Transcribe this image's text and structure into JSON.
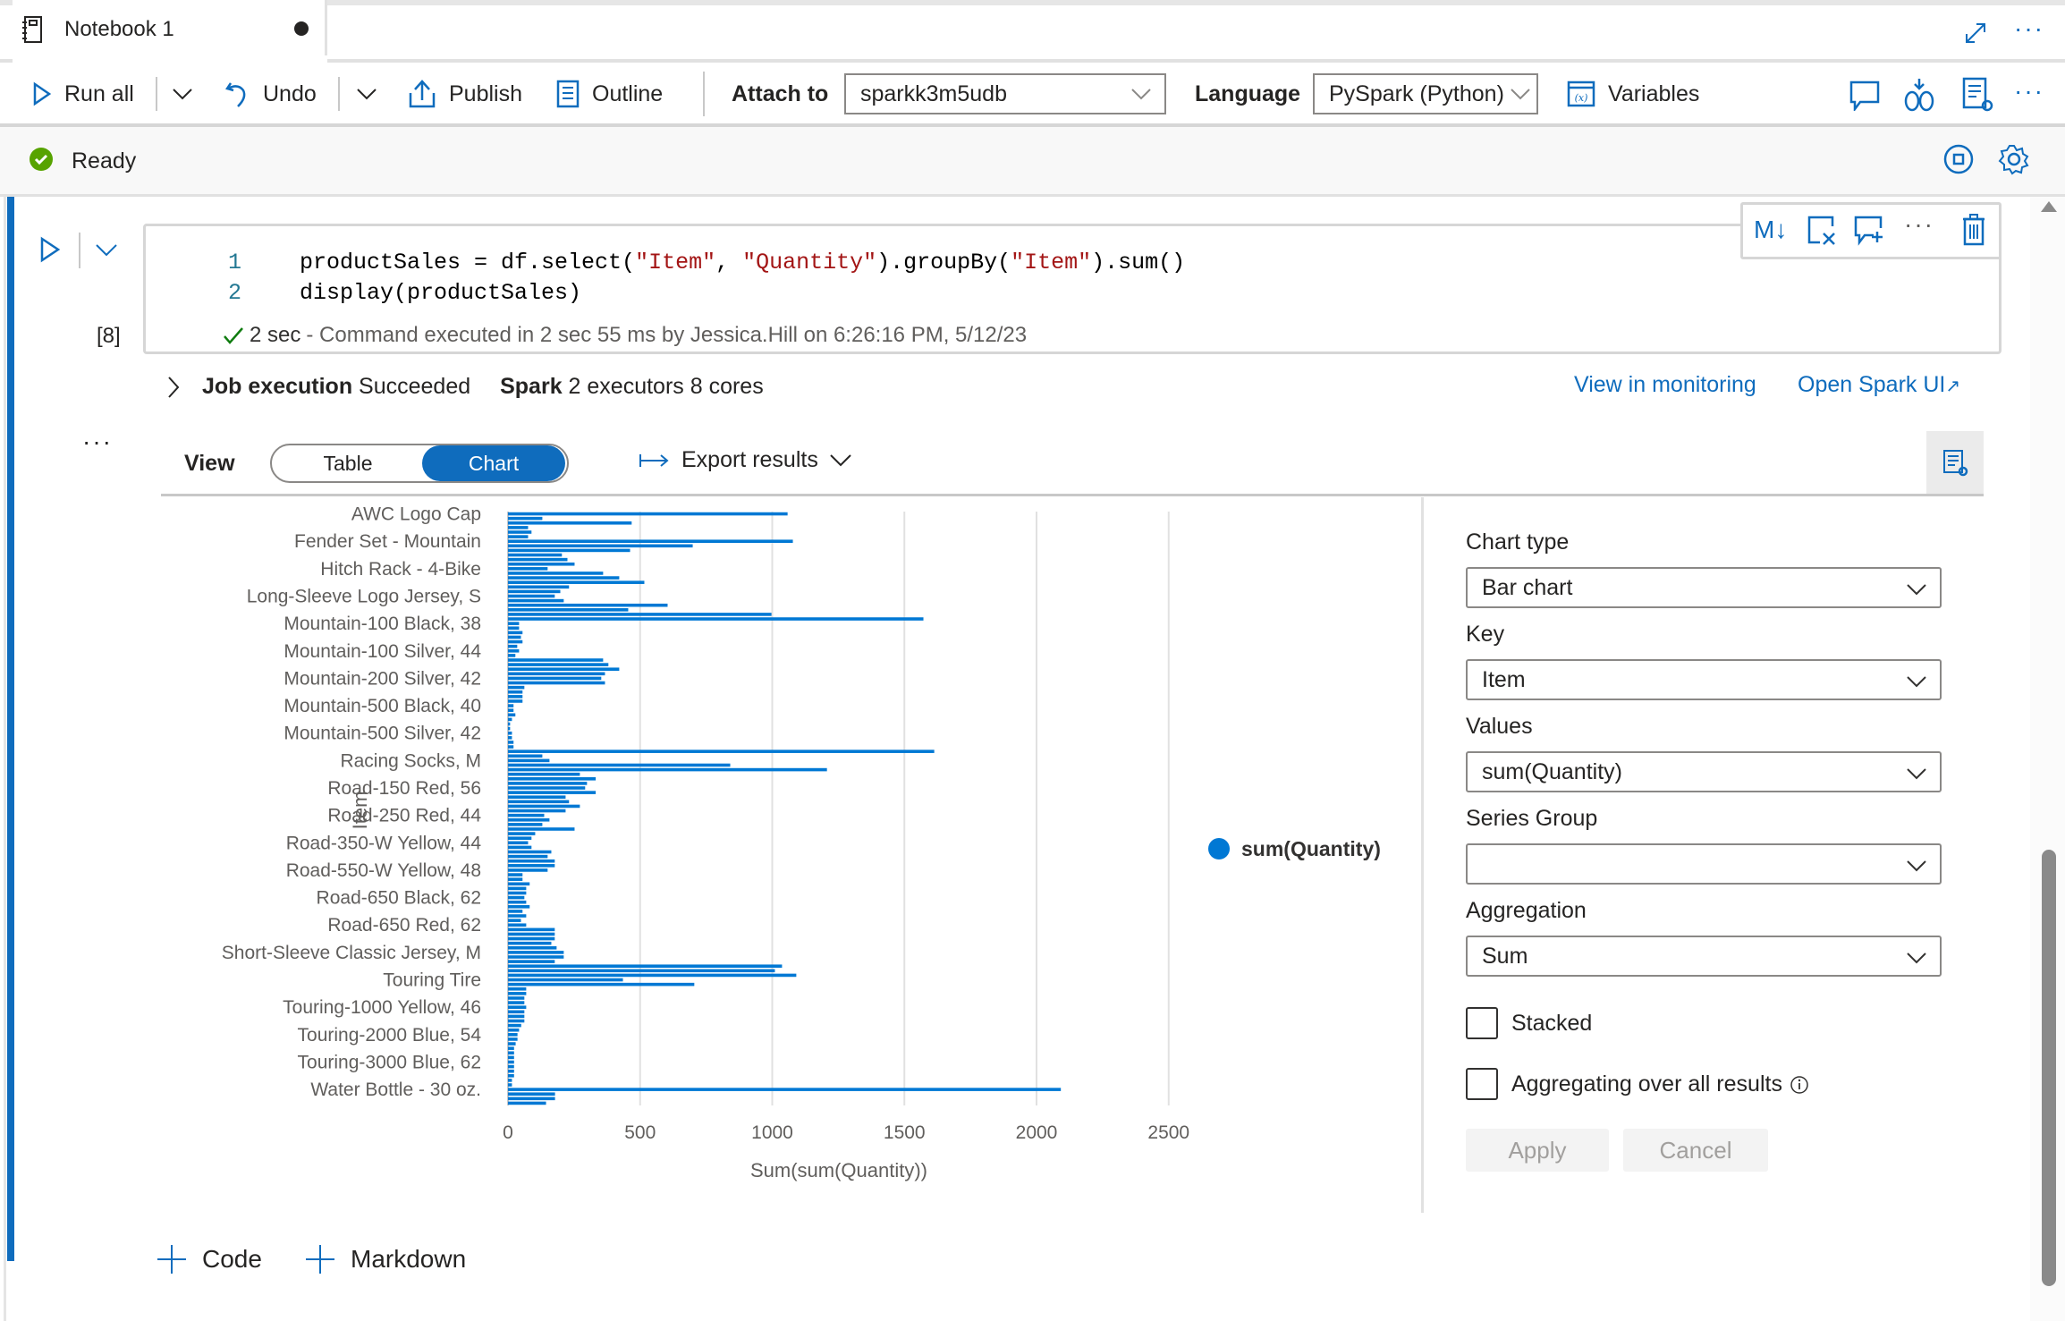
{
  "tab": {
    "title": "Notebook 1",
    "unsaved": true
  },
  "window_actions": {
    "expand_icon": "expand-icon",
    "more_icon": "more-icon"
  },
  "toolbar": {
    "run_all": "Run all",
    "undo": "Undo",
    "publish": "Publish",
    "outline": "Outline",
    "attach_to_label": "Attach to",
    "attach_to_value": "sparkk3m5udb",
    "language_label": "Language",
    "language_value": "PySpark (Python)",
    "variables": "Variables"
  },
  "status": {
    "text": "Ready",
    "color": "#57a300"
  },
  "cell": {
    "exec_count": "[8]",
    "lines": [
      {
        "no": "1",
        "parts": [
          "productSales = df.select(",
          "\"Item\"",
          ", ",
          "\"Quantity\"",
          ").groupBy(",
          "\"Item\"",
          ").sum()"
        ]
      },
      {
        "no": "2",
        "parts": [
          "display(productSales)"
        ]
      }
    ],
    "exec_duration": "2 sec",
    "exec_message": " - Command executed in 2 sec 55 ms by Jessica.Hill on 6:26:16 PM, 5/12/23",
    "toolbar": {
      "markdown_label": "M↓"
    }
  },
  "job": {
    "label": "Job execution",
    "status": "Succeeded",
    "spark_label": "Spark",
    "spark_info": "2 executors 8 cores",
    "view_monitoring": "View in monitoring",
    "open_spark_ui": "Open Spark UI"
  },
  "view": {
    "label": "View",
    "options": [
      "Table",
      "Chart"
    ],
    "selected": "Chart",
    "export": "Export results"
  },
  "settings": {
    "chart_type_label": "Chart type",
    "chart_type": "Bar chart",
    "key_label": "Key",
    "key": "Item",
    "values_label": "Values",
    "values": "sum(Quantity)",
    "series_group_label": "Series Group",
    "series_group": "",
    "aggregation_label": "Aggregation",
    "aggregation": "Sum",
    "stacked_label": "Stacked",
    "stacked": false,
    "aggregating_label": "Aggregating over all results",
    "aggregating": false,
    "apply": "Apply",
    "cancel": "Cancel"
  },
  "add_cell": {
    "code": "Code",
    "markdown": "Markdown"
  },
  "colors": {
    "accent": "#0f6cbd",
    "bar": "#0078d4"
  },
  "chart_data": {
    "type": "bar",
    "orientation": "horizontal",
    "xlabel": "Sum(sum(Quantity))",
    "ylabel": "Item",
    "xlim": [
      0,
      2500
    ],
    "xticks": [
      0,
      500,
      1000,
      1500,
      2000,
      2500
    ],
    "grid": true,
    "legend": {
      "entries": [
        "sum(Quantity)"
      ],
      "position": "right"
    },
    "visible_category_labels": [
      {
        "index": 0,
        "label": "AWC Logo Cap"
      },
      {
        "index": 6,
        "label": "Fender Set - Mountain"
      },
      {
        "index": 12,
        "label": "Hitch Rack - 4-Bike"
      },
      {
        "index": 18,
        "label": "Long-Sleeve Logo Jersey, S"
      },
      {
        "index": 24,
        "label": "Mountain-100 Black, 38"
      },
      {
        "index": 30,
        "label": "Mountain-100 Silver, 44"
      },
      {
        "index": 36,
        "label": "Mountain-200 Silver, 42"
      },
      {
        "index": 42,
        "label": "Mountain-500 Black, 40"
      },
      {
        "index": 48,
        "label": "Mountain-500 Silver, 42"
      },
      {
        "index": 54,
        "label": "Racing Socks, M"
      },
      {
        "index": 60,
        "label": "Road-150 Red, 56"
      },
      {
        "index": 66,
        "label": "Road-250 Red, 44"
      },
      {
        "index": 72,
        "label": "Road-350-W Yellow, 44"
      },
      {
        "index": 78,
        "label": "Road-550-W Yellow, 48"
      },
      {
        "index": 84,
        "label": "Road-650 Black, 62"
      },
      {
        "index": 90,
        "label": "Road-650 Red, 62"
      },
      {
        "index": 96,
        "label": "Short-Sleeve Classic Jersey, M"
      },
      {
        "index": 102,
        "label": "Touring Tire"
      },
      {
        "index": 108,
        "label": "Touring-1000 Yellow, 46"
      },
      {
        "index": 114,
        "label": "Touring-2000 Blue, 54"
      },
      {
        "index": 120,
        "label": "Touring-3000 Blue, 62"
      },
      {
        "index": 126,
        "label": "Water Bottle - 30 oz."
      }
    ],
    "values": [
      1058,
      130,
      468,
      76,
      89,
      76,
      1078,
      699,
      462,
      204,
      225,
      252,
      150,
      360,
      421,
      516,
      231,
      198,
      177,
      211,
      604,
      455,
      997,
      1572,
      42,
      42,
      55,
      49,
      55,
      35,
      42,
      28,
      360,
      380,
      421,
      367,
      353,
      367,
      62,
      55,
      55,
      55,
      21,
      21,
      28,
      15,
      8,
      8,
      15,
      15,
      21,
      21,
      1613,
      130,
      157,
      841,
      1207,
      272,
      332,
      299,
      292,
      332,
      218,
      231,
      272,
      218,
      137,
      157,
      130,
      252,
      103,
      89,
      76,
      89,
      164,
      150,
      177,
      177,
      150,
      55,
      55,
      82,
      69,
      69,
      62,
      69,
      82,
      55,
      69,
      49,
      69,
      177,
      177,
      177,
      164,
      184,
      211,
      211,
      177,
      1037,
      1010,
      1091,
      435,
      705,
      69,
      69,
      62,
      62,
      69,
      62,
      62,
      62,
      50,
      42,
      36,
      36,
      29,
      23,
      23,
      23,
      23,
      23,
      23,
      23,
      15,
      15,
      2092,
      178,
      178,
      144
    ]
  }
}
